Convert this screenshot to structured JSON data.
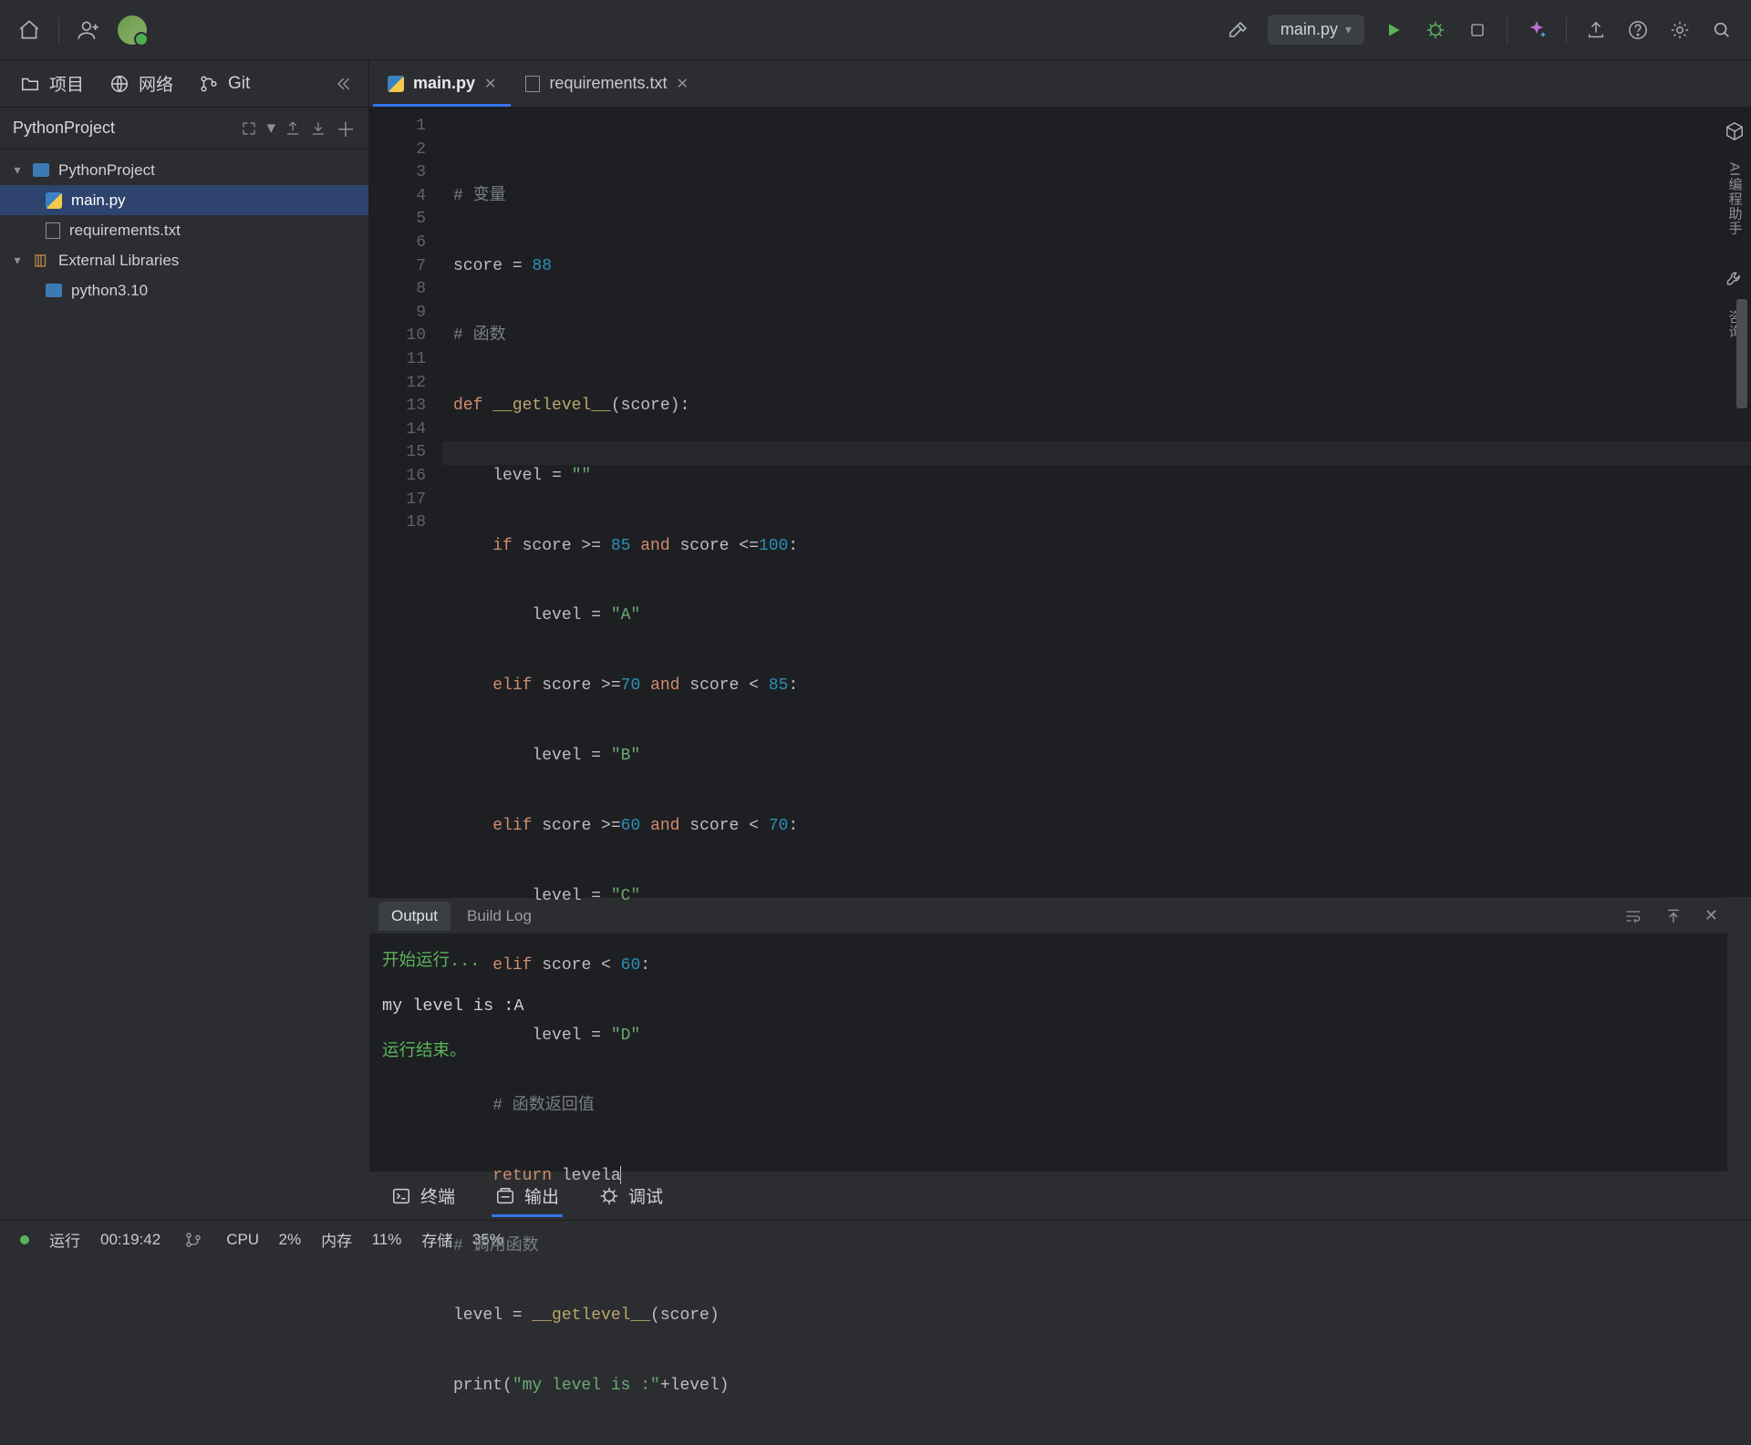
{
  "topbar": {
    "run_config": "main.py"
  },
  "sidebar_tabs": {
    "project": "项目",
    "network": "网络",
    "git": "Git"
  },
  "project": {
    "title": "PythonProject",
    "tree": {
      "root": "PythonProject",
      "main": "main.py",
      "req": "requirements.txt",
      "extlib": "External Libraries",
      "py310": "python3.10"
    }
  },
  "editor_tabs": {
    "main": "main.py",
    "req": "requirements.txt"
  },
  "code": {
    "lines": [
      "1",
      "2",
      "3",
      "4",
      "5",
      "6",
      "7",
      "8",
      "9",
      "10",
      "11",
      "12",
      "13",
      "14",
      "15",
      "16",
      "17",
      "18"
    ],
    "c1": "# 变量",
    "c2a": "score ",
    "c2b": "= ",
    "c2c": "88",
    "c3": "# 函数",
    "c4a": "def ",
    "c4b": "__getlevel__",
    "c4c": "(score):",
    "c5a": "    level = ",
    "c5b": "\"\"",
    "c6a": "    ",
    "c6b": "if ",
    "c6c": "score >= ",
    "c6d": "85 ",
    "c6e": "and ",
    "c6f": "score <=",
    "c6g": "100",
    "c6h": ":",
    "c7a": "        level = ",
    "c7b": "\"A\"",
    "c8a": "    ",
    "c8b": "elif ",
    "c8c": "score >=",
    "c8d": "70 ",
    "c8e": "and ",
    "c8f": "score < ",
    "c8g": "85",
    "c8h": ":",
    "c9a": "        level = ",
    "c9b": "\"B\"",
    "c10a": "    ",
    "c10b": "elif ",
    "c10c": "score >=",
    "c10d": "60 ",
    "c10e": "and ",
    "c10f": "score < ",
    "c10g": "70",
    "c10h": ":",
    "c11a": "        level = ",
    "c11b": "\"C\"",
    "c12a": "    ",
    "c12b": "elif ",
    "c12c": "score < ",
    "c12d": "60",
    "c12e": ":",
    "c13a": "        level = ",
    "c13b": "\"D\"",
    "c14": "    # 函数返回值",
    "c15a": "    ",
    "c15b": "return ",
    "c15c": "levela",
    "c16": "# 调用函数",
    "c17a": "level = ",
    "c17b": "__getlevel__",
    "c17c": "(score)",
    "c18a": "print(",
    "c18b": "\"my level is :\"",
    "c18c": "+level)"
  },
  "right_rail": {
    "label1": "AI编程助手",
    "label2": "咨询"
  },
  "panel": {
    "tab_output": "Output",
    "tab_build": "Build Log",
    "line1": "开始运行...",
    "line2": "my level is :A",
    "line3": "运行结束。"
  },
  "bottom_tools": {
    "terminal": "终端",
    "output": "输出",
    "debug": "调试"
  },
  "status": {
    "run_label": "运行",
    "run_time": "00:19:42",
    "cpu_label": "CPU",
    "cpu_val": "2%",
    "mem_label": "内存",
    "mem_val": "11%",
    "disk_label": "存储",
    "disk_val": "35%"
  }
}
